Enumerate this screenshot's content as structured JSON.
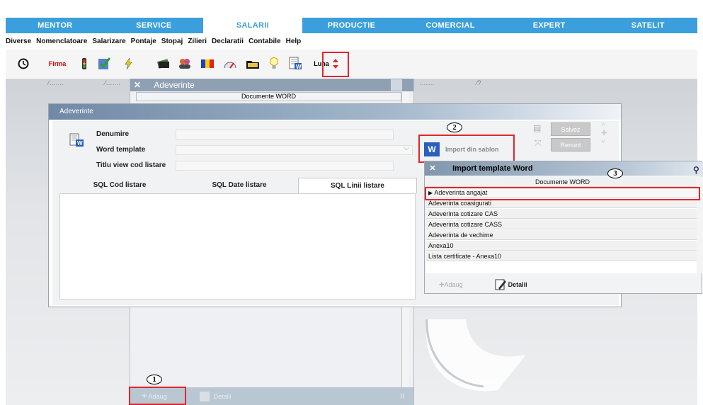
{
  "main_tabs": [
    "MENTOR",
    "SERVICE",
    "SALARII",
    "PRODUCTIE",
    "COMERCIAL",
    "EXPERT",
    "SATELIT"
  ],
  "menu": [
    "Diverse",
    "Nomenclatoare",
    "Salarizare",
    "Pontaje",
    "Stopaj",
    "Zilieri",
    "Declaratii",
    "Contabile",
    "Help"
  ],
  "toolbar": {
    "firma_label": "Firma",
    "luna_label": "Luna"
  },
  "bg_headers": {
    "a": "⁄…….",
    "b": "⁄…….",
    "c": ".……",
    "d": "⁄?"
  },
  "back_panel": {
    "title": "Adeverinte",
    "list_header": "Documente WORD",
    "add_label": "Adaug",
    "details_label": "Detalii",
    "r_label": "R"
  },
  "adeverinte": {
    "title": "Adeverinte",
    "fields": {
      "denumire": "Denumire",
      "word_template": "Word template",
      "titlu_view": "Titlu view cod listare"
    },
    "tabs": [
      "SQL Cod listare",
      "SQL Date listare",
      "SQL Linii listare"
    ],
    "import_btn": "Import din sablon",
    "salvez": "Salvez",
    "renunt": "Renunt"
  },
  "import_dialog": {
    "title": "Import template Word",
    "header": "Documente WORD",
    "rows": [
      "Adeverinta angajat",
      "Adeverinta coasigurati",
      "Adeverinta cotizare  CAS",
      "Adeverinta cotizare CASS",
      "Adeverinta de vechime",
      "Anexa10",
      "Lista certificate - Anexa10"
    ],
    "add_label": "Adaug",
    "details_label": "Detalii"
  },
  "callouts": [
    "1",
    "2",
    "3"
  ]
}
